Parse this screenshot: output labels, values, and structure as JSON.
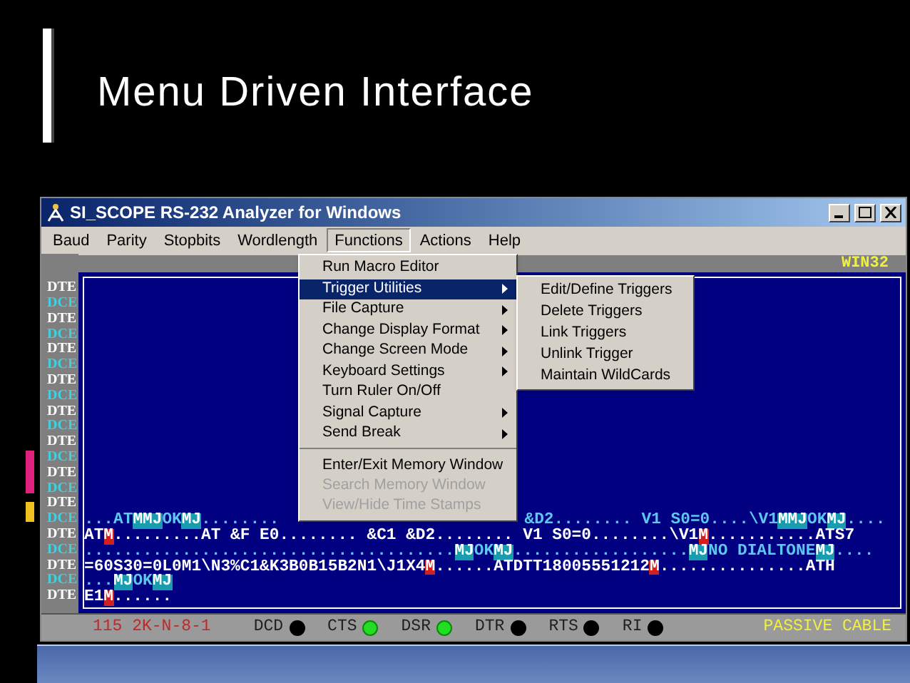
{
  "slide": {
    "title": "Menu Driven Interface"
  },
  "window": {
    "title": "SI_SCOPE RS-232 Analyzer for Windows"
  },
  "menubar": [
    {
      "label": "Baud",
      "selected": false
    },
    {
      "label": "Parity",
      "selected": false
    },
    {
      "label": "Stopbits",
      "selected": false
    },
    {
      "label": "Wordlength",
      "selected": false
    },
    {
      "label": "Functions",
      "selected": true
    },
    {
      "label": "Actions",
      "selected": false
    },
    {
      "label": "Help",
      "selected": false
    }
  ],
  "menu": {
    "items": [
      {
        "label": "Run Macro Editor",
        "submenu": false,
        "selected": false,
        "disabled": false,
        "separator_before": false
      },
      {
        "label": "Trigger Utilities",
        "submenu": true,
        "selected": true,
        "disabled": false,
        "separator_before": false
      },
      {
        "label": "File Capture",
        "submenu": true,
        "selected": false,
        "disabled": false,
        "separator_before": false
      },
      {
        "label": "Change Display Format",
        "submenu": true,
        "selected": false,
        "disabled": false,
        "separator_before": false
      },
      {
        "label": "Change Screen Mode",
        "submenu": true,
        "selected": false,
        "disabled": false,
        "separator_before": false
      },
      {
        "label": "Keyboard Settings",
        "submenu": true,
        "selected": false,
        "disabled": false,
        "separator_before": false
      },
      {
        "label": "Turn Ruler On/Off",
        "submenu": false,
        "selected": false,
        "disabled": false,
        "separator_before": false
      },
      {
        "label": "Signal Capture",
        "submenu": true,
        "selected": false,
        "disabled": false,
        "separator_before": false
      },
      {
        "label": "Send Break",
        "submenu": true,
        "selected": false,
        "disabled": false,
        "separator_before": false
      },
      {
        "label": "Enter/Exit Memory Window",
        "submenu": false,
        "selected": false,
        "disabled": false,
        "separator_before": true
      },
      {
        "label": "Search Memory Window",
        "submenu": false,
        "selected": false,
        "disabled": true,
        "separator_before": false
      },
      {
        "label": "View/Hide Time Stamps",
        "submenu": false,
        "selected": false,
        "disabled": true,
        "separator_before": false
      }
    ],
    "submenu": [
      "Edit/Define Triggers",
      "Delete Triggers",
      "Link Triggers",
      "Unlink Trigger",
      "Maintain WildCards"
    ]
  },
  "header": {
    "mode": "WIN32"
  },
  "side_labels": [
    {
      "text": "DTE",
      "kind": "dte"
    },
    {
      "text": "DCE",
      "kind": "dce"
    },
    {
      "text": "DTE",
      "kind": "dte"
    },
    {
      "text": "DCE",
      "kind": "dce"
    },
    {
      "text": "DTE",
      "kind": "dte"
    },
    {
      "text": "DCE",
      "kind": "dce"
    },
    {
      "text": "DTE",
      "kind": "dte"
    },
    {
      "text": "DCE",
      "kind": "dce"
    },
    {
      "text": "DTE",
      "kind": "dte"
    },
    {
      "text": "DCE",
      "kind": "dce"
    },
    {
      "text": "DTE",
      "kind": "dte"
    },
    {
      "text": "DCE",
      "kind": "dce"
    },
    {
      "text": "DTE",
      "kind": "dte"
    },
    {
      "text": "DCE",
      "kind": "dce"
    },
    {
      "text": "DTE",
      "kind": "dte"
    },
    {
      "text": "DCE",
      "kind": "dce"
    },
    {
      "text": "DTE",
      "kind": "dte"
    },
    {
      "text": "DCE",
      "kind": "dce"
    },
    {
      "text": "DTE",
      "kind": "dte"
    },
    {
      "text": "DCE",
      "kind": "dce"
    },
    {
      "text": "DTE",
      "kind": "dte"
    }
  ],
  "terminal": [
    {
      "kind": "dce",
      "segments": [
        {
          "text": "...AT",
          "kind": "plain"
        },
        {
          "text": "MMJ",
          "kind": "ctrl"
        },
        {
          "text": "OK",
          "kind": "plain"
        },
        {
          "text": "MJ",
          "kind": "ctrl"
        },
        {
          "text": "........",
          "kind": "plain"
        }
      ],
      "right_segments": [
        {
          "text": "&D2........ V1 S0=0....\\V1",
          "kind": "plain"
        },
        {
          "text": "MMJ",
          "kind": "ctrl"
        },
        {
          "text": "OK",
          "kind": "plain"
        },
        {
          "text": "MJ",
          "kind": "ctrl"
        },
        {
          "text": "....",
          "kind": "plain"
        }
      ]
    },
    {
      "kind": "dte",
      "segments": [
        {
          "text": "AT",
          "kind": "plain"
        },
        {
          "text": "M",
          "kind": "ctrl"
        },
        {
          "text": ".........AT &F E0........ &C1 &D2........ V1 S0=0........\\V1",
          "kind": "plain"
        },
        {
          "text": "M",
          "kind": "ctrl"
        },
        {
          "text": "...........ATS7",
          "kind": "plain"
        }
      ]
    },
    {
      "kind": "dce",
      "segments": [
        {
          "text": "......................................",
          "kind": "plain"
        },
        {
          "text": "MJ",
          "kind": "ctrl"
        },
        {
          "text": "OK",
          "kind": "plain"
        },
        {
          "text": "MJ",
          "kind": "ctrl"
        },
        {
          "text": "..................",
          "kind": "plain"
        },
        {
          "text": "MJ",
          "kind": "ctrl"
        },
        {
          "text": "NO DIALTONE",
          "kind": "plain"
        },
        {
          "text": "MJ",
          "kind": "ctrl"
        },
        {
          "text": "....",
          "kind": "plain"
        }
      ]
    },
    {
      "kind": "dte",
      "segments": [
        {
          "text": "=60S30=0L0M1\\N3%C1&K3B0B15B2N1\\J1X4",
          "kind": "plain"
        },
        {
          "text": "M",
          "kind": "ctrl"
        },
        {
          "text": "......ATDTT18005551212",
          "kind": "plain"
        },
        {
          "text": "M",
          "kind": "ctrl"
        },
        {
          "text": "...............ATH",
          "kind": "plain"
        }
      ]
    },
    {
      "kind": "dce",
      "segments": [
        {
          "text": "...",
          "kind": "plain"
        },
        {
          "text": "MJ",
          "kind": "ctrl"
        },
        {
          "text": "OK",
          "kind": "plain"
        },
        {
          "text": "MJ",
          "kind": "ctrl"
        }
      ]
    },
    {
      "kind": "dte",
      "segments": [
        {
          "text": "E1",
          "kind": "plain"
        },
        {
          "text": "M",
          "kind": "ctrl"
        },
        {
          "text": "......",
          "kind": "plain"
        }
      ]
    }
  ],
  "status_bar": {
    "settings": "115 2K-N-8-1",
    "signals": [
      {
        "label": "DCD",
        "on": false
      },
      {
        "label": "CTS",
        "on": true
      },
      {
        "label": "DSR",
        "on": true
      },
      {
        "label": "DTR",
        "on": false
      },
      {
        "label": "RTS",
        "on": false
      },
      {
        "label": "RI",
        "on": false
      }
    ],
    "cable": "PASSIVE CABLE"
  }
}
